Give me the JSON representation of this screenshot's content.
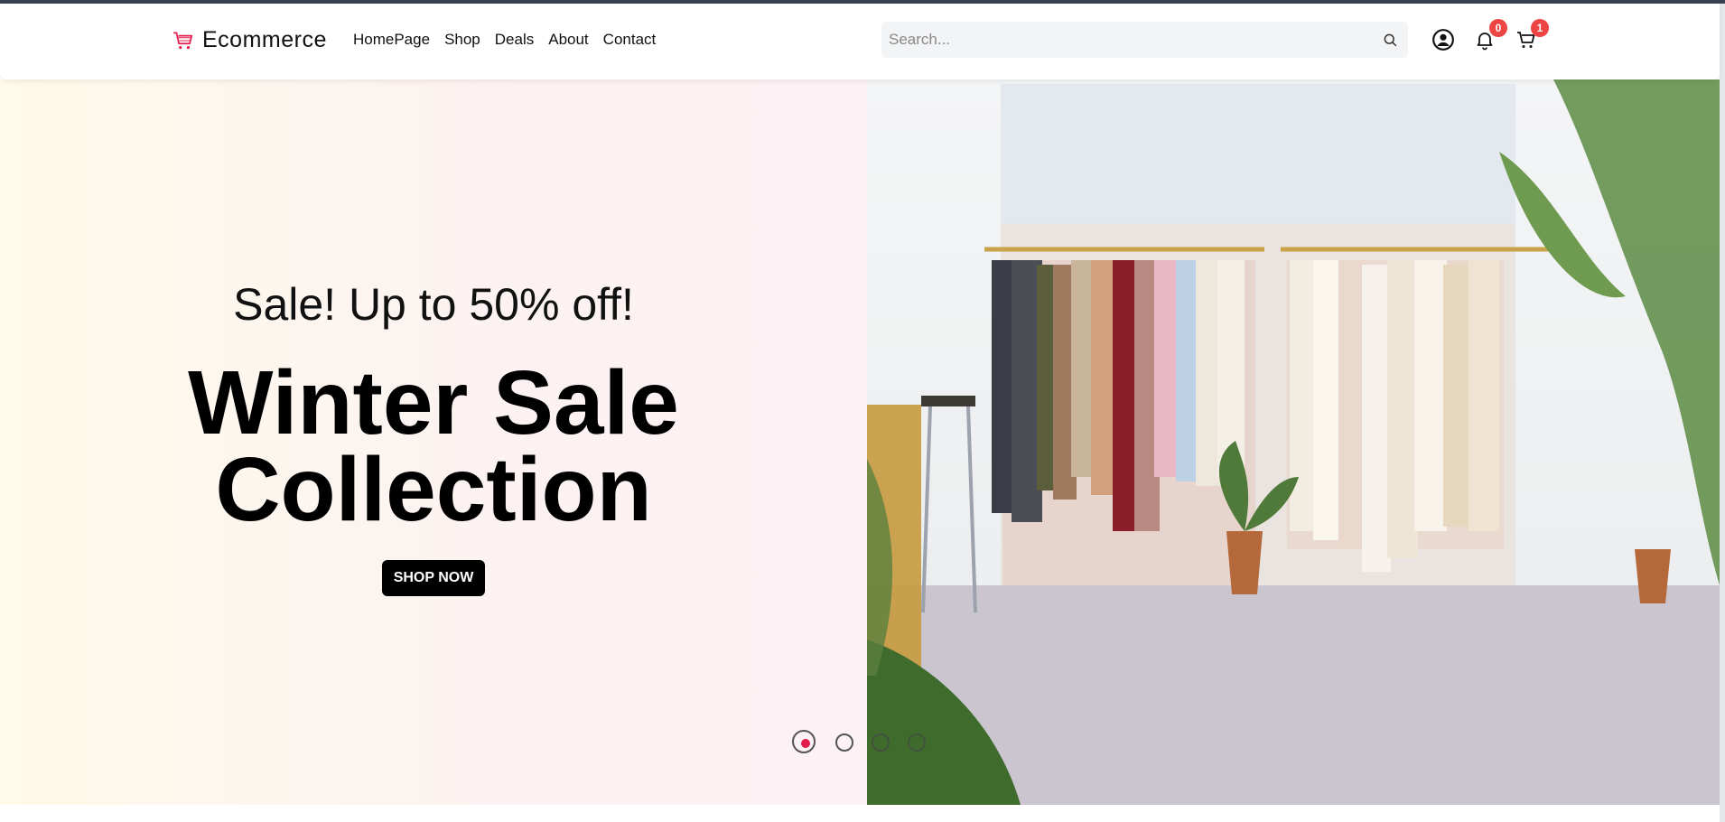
{
  "brand": {
    "name": "Ecommerce",
    "icon": "shopping-cart-icon",
    "icon_color": "#e11d48"
  },
  "nav": {
    "items": [
      {
        "label": "HomePage"
      },
      {
        "label": "Shop"
      },
      {
        "label": "Deals"
      },
      {
        "label": "About"
      },
      {
        "label": "Contact"
      }
    ]
  },
  "search": {
    "placeholder": "Search...",
    "value": "",
    "icon": "search-icon"
  },
  "user_actions": {
    "profile_icon": "user-circle-icon",
    "notifications": {
      "icon": "bell-icon",
      "count": "0"
    },
    "cart": {
      "icon": "cart-icon",
      "count": "1"
    }
  },
  "hero": {
    "subtitle": "Sale! Up to 50% off!",
    "title_line1": "Winter Sale",
    "title_line2": "Collection",
    "cta": "SHOP NOW",
    "slides_total": 4,
    "active_slide": 1
  },
  "colors": {
    "accent": "#e11d48",
    "badge": "#ef4444",
    "button": "#000000"
  }
}
